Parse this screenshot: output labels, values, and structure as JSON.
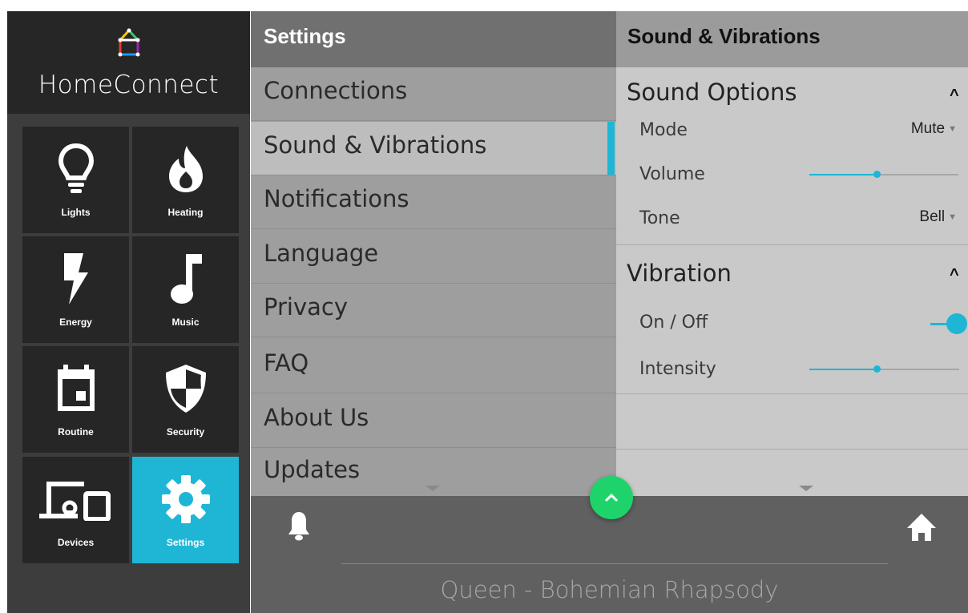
{
  "app": {
    "title": "HomeConnect"
  },
  "sidebar": {
    "tiles": [
      {
        "label": "Lights",
        "icon": "lightbulb-icon"
      },
      {
        "label": "Heating",
        "icon": "flame-icon"
      },
      {
        "label": "Energy",
        "icon": "lightning-bolt-icon"
      },
      {
        "label": "Music",
        "icon": "music-note-icon"
      },
      {
        "label": "Routine",
        "icon": "calendar-icon"
      },
      {
        "label": "Security",
        "icon": "shield-icon"
      },
      {
        "label": "Devices",
        "icon": "devices-icon"
      },
      {
        "label": "Settings",
        "icon": "gear-icon",
        "active": true
      }
    ]
  },
  "settings": {
    "title": "Settings",
    "items": [
      "Connections",
      "Sound & Vibrations",
      "Notifications",
      "Language",
      "Privacy",
      "FAQ",
      "About Us",
      "Updates"
    ],
    "selected": "Sound & Vibrations"
  },
  "detail": {
    "title": "Sound & Vibrations",
    "sound": {
      "title": "Sound Options",
      "mode_label": "Mode",
      "mode_value": "Mute",
      "volume_label": "Volume",
      "volume_level": 0.45,
      "tone_label": "Tone",
      "tone_value": "Bell"
    },
    "vibration": {
      "title": "Vibration",
      "onoff_label": "On / Off",
      "onoff_value": true,
      "intensity_label": "Intensity",
      "intensity_level": 0.45
    }
  },
  "bottom": {
    "now_playing": "Queen - Bohemian Rhapsody"
  },
  "colors": {
    "accent": "#1fb6d6",
    "fab": "#1fd36b",
    "sidebar": "#262626",
    "bottom_bar": "#606060"
  }
}
